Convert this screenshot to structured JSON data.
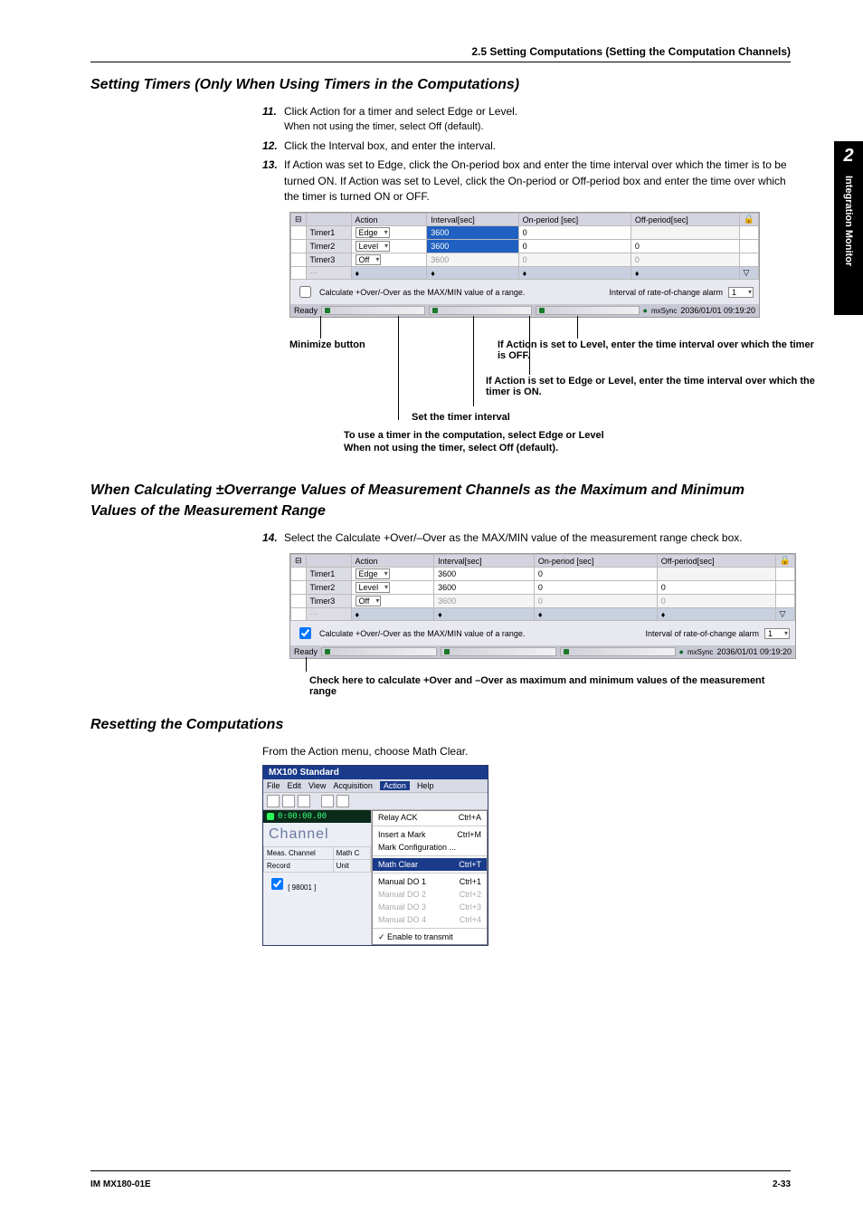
{
  "crumb": "2.5  Setting Computations (Setting the Computation Channels)",
  "side_tab": {
    "num": "2",
    "label": "Integration Monitor"
  },
  "h_timers": "Setting Timers (Only When Using Timers in the Computations)",
  "steps_a": [
    {
      "n": "11.",
      "text": "Click Action for a timer and select Edge or Level.",
      "sub": "When not using the timer, select Off (default)."
    },
    {
      "n": "12.",
      "text": "Click the Interval box, and enter the interval."
    },
    {
      "n": "13.",
      "text": "If Action was set to Edge, click the On-period box and enter the time interval over which the timer is to be turned ON. If Action was set to Level, click the On-period or Off-period box and enter the time over which the timer is turned ON or OFF."
    }
  ],
  "timer_table": {
    "headers": [
      "",
      "Action",
      "Interval[sec]",
      "On-period [sec]",
      "Off-period[sec]",
      "lock"
    ],
    "rows": [
      {
        "name": "Timer1",
        "action": "Edge",
        "interval": "3600",
        "on": "0",
        "off": ""
      },
      {
        "name": "Timer2",
        "action": "Level",
        "interval": "3600",
        "on": "0",
        "off": "0"
      },
      {
        "name": "Timer3",
        "action": "Off",
        "interval": "3600",
        "on": "0",
        "off": "0"
      }
    ],
    "checkbox_label": "Calculate +Over/-Over as the MAX/MIN value of a range.",
    "rate_label": "Interval of rate-of-change alarm",
    "rate_value": "1",
    "status_ready": "Ready",
    "status_right": "2036/01/01 09:19:20"
  },
  "callouts": {
    "minimize": "Minimize button",
    "off": "If Action is set to Level, enter the time interval over which the timer is OFF.",
    "on": "If Action is set to Edge or Level, enter the time interval over which the timer is ON.",
    "interval": "Set the timer interval",
    "bottom1": "To use a timer in the computation, select Edge or Level",
    "bottom2": "When not using the timer, select Off (default)."
  },
  "h_over": "When Calculating ±Overrange Values of Measurement Channels as the Maximum and Minimum Values of the Measurement Range",
  "steps_b": [
    {
      "n": "14.",
      "text": "Select the Calculate +Over/–Over as the MAX/MIN value of the measurement range check box."
    }
  ],
  "check_caption": "Check here to calculate +Over and –Over as maximum and minimum values of the measurement range",
  "h_reset": "Resetting the Computations",
  "reset_text": "From the Action menu, choose Math Clear.",
  "app": {
    "title": "MX100 Standard",
    "menus": [
      "File",
      "Edit",
      "View",
      "Acquisition",
      "Action",
      "Help"
    ],
    "time": "0:00:00.00",
    "channel": "Channel",
    "left_rows": [
      [
        "Meas. Channel",
        "Math C"
      ],
      [
        "Record",
        "Unit"
      ]
    ],
    "left_foot": "[ 98001 ]",
    "dd": [
      {
        "label": "Relay ACK",
        "shortcut": "Ctrl+A",
        "state": ""
      },
      {
        "label": "Insert a Mark",
        "shortcut": "Ctrl+M",
        "state": ""
      },
      {
        "label": "Mark Configuration ...",
        "shortcut": "",
        "state": ""
      },
      {
        "label": "Math Clear",
        "shortcut": "Ctrl+T",
        "state": "hover"
      },
      {
        "label": "Manual DO 1",
        "shortcut": "Ctrl+1",
        "state": ""
      },
      {
        "label": "Manual DO 2",
        "shortcut": "Ctrl+2",
        "state": "disabled"
      },
      {
        "label": "Manual DO 3",
        "shortcut": "Ctrl+3",
        "state": "disabled"
      },
      {
        "label": "Manual DO 4",
        "shortcut": "Ctrl+4",
        "state": "disabled"
      }
    ],
    "dd_foot": "✓ Enable to transmit"
  },
  "footer": {
    "left": "IM MX180-01E",
    "right": "2-33"
  }
}
